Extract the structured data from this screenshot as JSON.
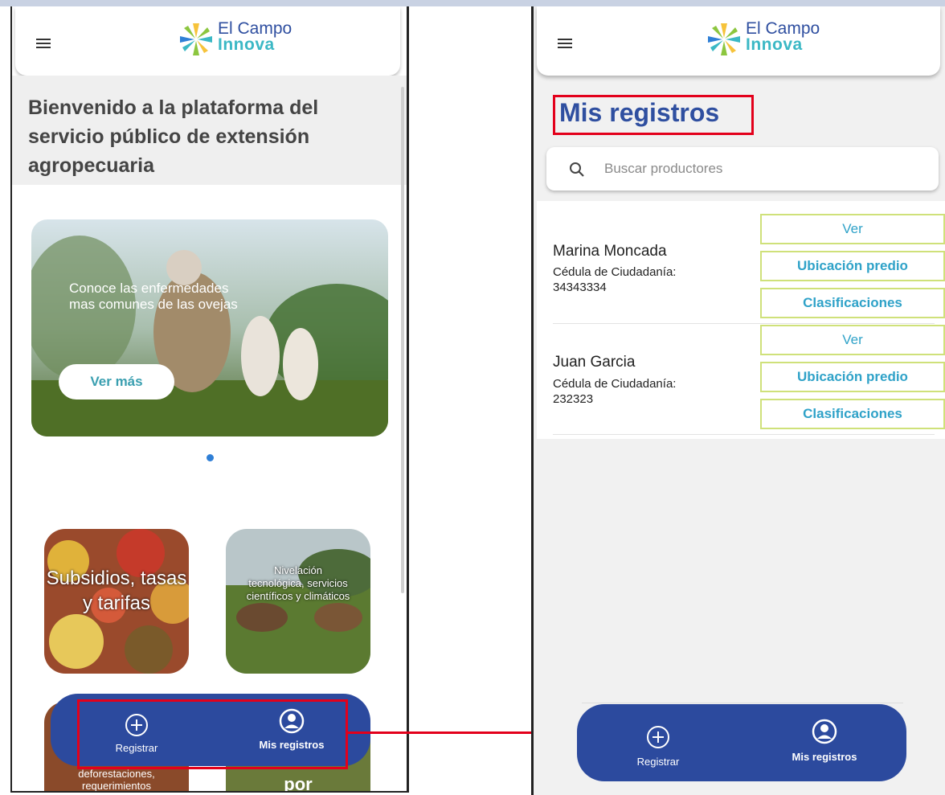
{
  "brand": {
    "line1": "El Campo",
    "line2": "Innova"
  },
  "left_screen": {
    "welcome_title": "Bienvenido a la plataforma del servicio público de extensión agropecuaria",
    "carousel": {
      "caption": "Conoce las enfermedades mas comunes de las ovejas",
      "button_label": "Ver más"
    },
    "tiles": [
      {
        "label": "Subsidios, tasas y tarifas"
      },
      {
        "label": "Nivelación tecnológica, servicios científicos y climáticos"
      }
    ],
    "partial_tiles": [
      {
        "label": "deforestaciones, requerimientos"
      },
      {
        "label": "por"
      }
    ],
    "nav": {
      "register_label": "Registrar",
      "records_label": "Mis registros"
    }
  },
  "right_screen": {
    "title": "Mis registros",
    "search": {
      "placeholder": "Buscar productores"
    },
    "records": [
      {
        "name": "Marina Moncada",
        "doc_type": "Cédula de Ciudadanía:",
        "doc_number": "34343334",
        "actions": [
          "Ver",
          "Ubicación predio",
          "Clasificaciones"
        ]
      },
      {
        "name": "Juan Garcia",
        "doc_type": "Cédula de Ciudadanía:",
        "doc_number": "232323",
        "actions": [
          "Ver",
          "Ubicación predio",
          "Clasificaciones"
        ]
      }
    ],
    "nav": {
      "register_label": "Registrar",
      "records_label": "Mis registros"
    }
  },
  "colors": {
    "primary": "#2c4a9e",
    "accent": "#3bb8c5",
    "highlight": "#e3001b",
    "button_border": "#cfe17a"
  }
}
